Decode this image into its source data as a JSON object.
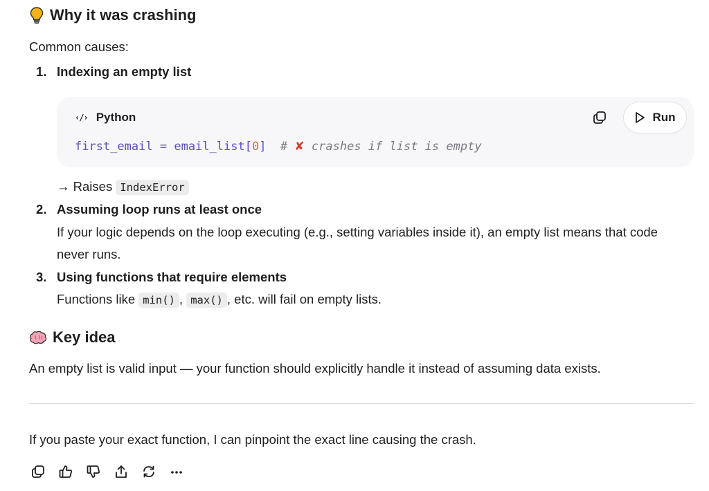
{
  "section1": {
    "icon": "lightbulb-icon",
    "title": "Why it was crashing",
    "intro": "Common causes:"
  },
  "causes": [
    {
      "number": "1.",
      "title": "Indexing an empty list"
    },
    {
      "number": "2.",
      "title": "Assuming loop runs at least once",
      "body": "If your logic depends on the loop executing (e.g., setting variables inside it), an empty list means that code never runs."
    },
    {
      "number": "3.",
      "title": "Using functions that require elements",
      "body_prefix": "Functions like ",
      "code1": "min()",
      "sep": ", ",
      "code2": "max()",
      "body_suffix": ", etc. will fail on empty lists."
    }
  ],
  "codeblock": {
    "language": "Python",
    "lang_icon": "code-icon",
    "run_label": "Run",
    "code": {
      "var": "first_email",
      "op": "=",
      "expr": "email_list[",
      "index": "0",
      "close": "]",
      "comment_hash": "#",
      "comment_mark": "✘",
      "comment_text": "crashes if list is empty"
    }
  },
  "raises": {
    "prefix": "→ Raises",
    "code": "IndexError"
  },
  "section2": {
    "icon": "brain-icon",
    "title": "Key idea",
    "body": "An empty list is valid input — your function should explicitly handle it instead of assuming data exists."
  },
  "closing": "If you paste your exact function, I can pinpoint the exact line causing the crash.",
  "actions": [
    "copy-icon",
    "thumbs-up-icon",
    "thumbs-down-icon",
    "share-icon",
    "regenerate-icon",
    "more-icon"
  ],
  "colors": {
    "code_bg": "#f7f6f9",
    "code_var": "#5b52b6",
    "code_number": "#c0793a",
    "code_comment": "#7a7a85",
    "cross_mark": "#d23b2a",
    "bulb": "#f2b417",
    "brain": "#f4a3b8"
  }
}
